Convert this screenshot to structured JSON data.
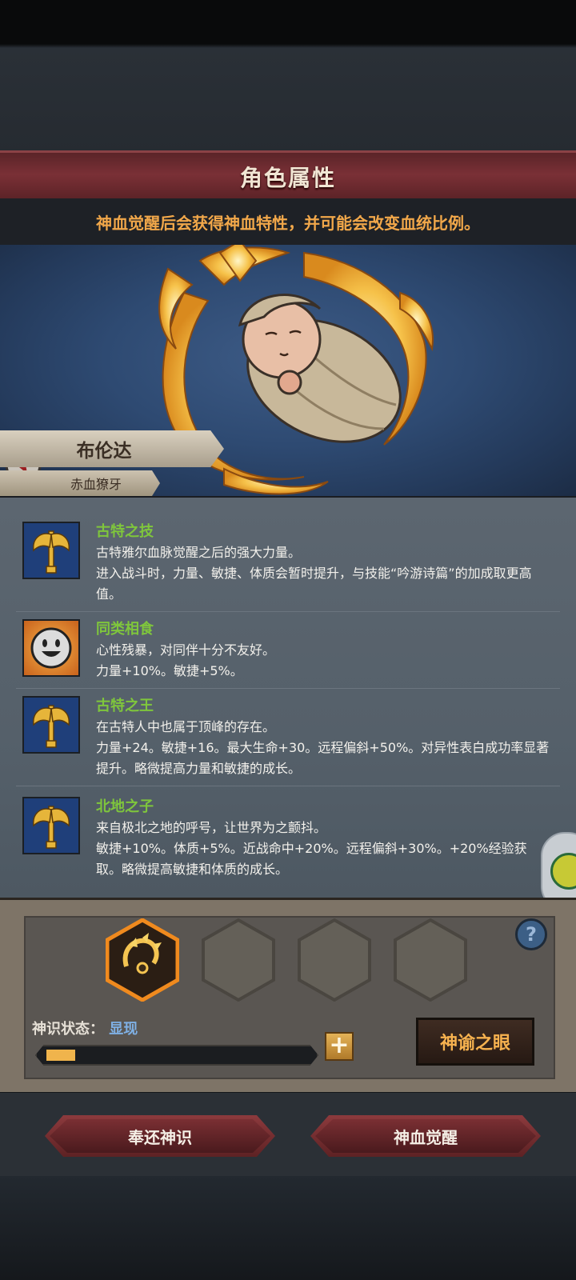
{
  "header": {
    "title": "角色属性",
    "notice": "神血觉醒后会获得神血特性，并可能会改变血统比例。"
  },
  "character": {
    "name": "布伦达",
    "title": "赤血獠牙",
    "shield_icon": "wolf-head-shield-icon"
  },
  "traits": [
    {
      "name": "古特之技",
      "icon": "golden-axe-icon",
      "lines": [
        "古特雅尔血脉觉醒之后的强大力量。",
        "进入战斗时，力量、敏捷、体质会暂时提升，与技能“吟游诗篇”的加成取更高值。"
      ]
    },
    {
      "name": "同类相食",
      "icon": "grin-face-icon",
      "lines": [
        "心性残暴，对同伴十分不友好。",
        "力量+10%。敏捷+5%。"
      ]
    },
    {
      "name": "古特之王",
      "icon": "golden-axe-icon",
      "lines": [
        "在古特人中也属于顶峰的存在。",
        "力量+24。敏捷+16。最大生命+30。远程偏斜+50%。对异性表白成功率显著提升。略微提高力量和敏捷的成长。"
      ]
    },
    {
      "name": "北地之子",
      "icon": "golden-axe-icon",
      "lines": [
        "来自极北之地的呼号，让世界为之颤抖。",
        "敏捷+10%。体质+5%。近战命中+20%。远程偏斜+30%。+20%经验获取。略微提高敏捷和体质的成长。"
      ]
    }
  ],
  "divine": {
    "state_label": "神识状态：",
    "state_value": "显现",
    "progress": 0.11,
    "plus_label": "+",
    "oracle_label": "神谕之眼",
    "help_label": "?"
  },
  "actions": {
    "return_label": "奉还神识",
    "awaken_label": "神血觉醒"
  },
  "colors": {
    "trait_name": "#7fc63c",
    "notice": "#f2a84a",
    "accent": "#f0b44c"
  }
}
